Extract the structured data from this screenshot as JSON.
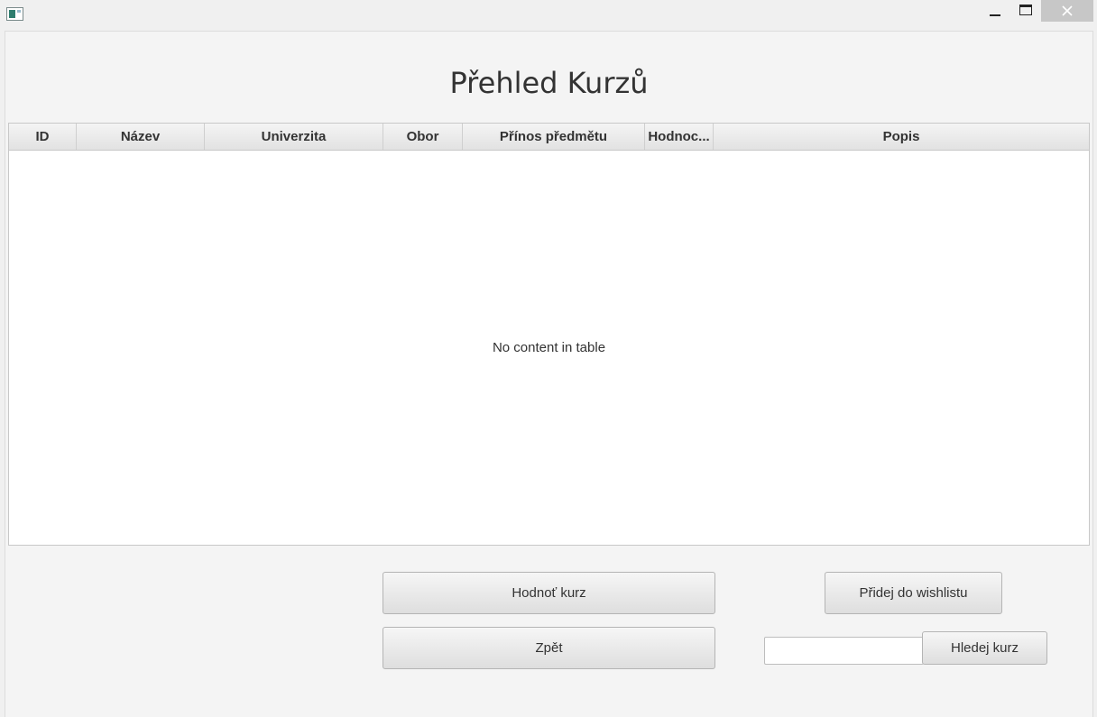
{
  "window": {
    "title": "",
    "icon": "app-window-icon",
    "controls": {
      "minimize": "minimize-icon",
      "maximize": "maximize-icon",
      "close": "close-icon",
      "close_bg": "#c7c7c7"
    }
  },
  "page": {
    "title": "Přehled Kurzů"
  },
  "table": {
    "columns": [
      {
        "label": "ID"
      },
      {
        "label": "Název"
      },
      {
        "label": "Univerzita"
      },
      {
        "label": "Obor"
      },
      {
        "label": "Přínos předmětu"
      },
      {
        "label": "Hodnoc..."
      },
      {
        "label": "Popis"
      }
    ],
    "rows": [],
    "empty_message": "No content in table"
  },
  "actions": {
    "rate_label": "Hodnoť kurz",
    "back_label": "Zpět",
    "wishlist_label": "Přidej do wishlistu",
    "search_label": "Hledej kurz",
    "search_value": "",
    "search_placeholder": ""
  }
}
